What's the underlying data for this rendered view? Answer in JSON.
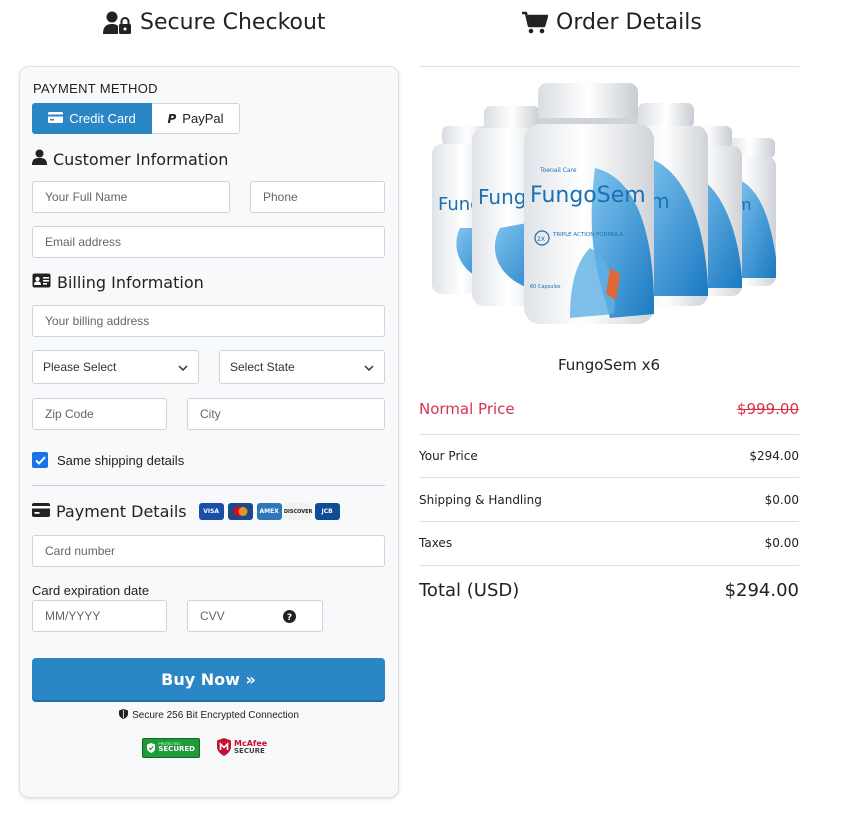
{
  "left_heading": "Secure Checkout",
  "right_heading": "Order Details",
  "payment": {
    "section_label": "PAYMENT METHOD",
    "tab_credit": "Credit Card",
    "tab_paypal": "PayPal"
  },
  "customer": {
    "title": "Customer Information",
    "full_name_placeholder": "Your Full Name",
    "phone_placeholder": "Phone",
    "email_placeholder": "Email address"
  },
  "billing": {
    "title": "Billing Information",
    "address_placeholder": "Your billing address",
    "country_select": "Please Select",
    "state_select": "Select State",
    "zip_placeholder": "Zip Code",
    "city_placeholder": "City",
    "same_shipping_label": "Same shipping details",
    "same_shipping_checked": true
  },
  "payment_details": {
    "title": "Payment Details",
    "card_logos": [
      "VISA",
      "MC",
      "AMEX",
      "DISCOVER",
      "JCB"
    ],
    "card_number_placeholder": "Card number",
    "expiry_label": "Card expiration date",
    "expiry_placeholder": "MM/YYYY",
    "cvv_placeholder": "CVV"
  },
  "buy_button": "Buy Now »",
  "secure_note": "Secure 256 Bit Encrypted Connection",
  "badges": {
    "secured_small": "SECURED",
    "secured_top": "PROTECTED",
    "mcafee_line1": "McAfee",
    "mcafee_line2": "SECURE"
  },
  "order": {
    "product_name": "FungoSem x6",
    "bottle_brand": "FungoSem",
    "bottle_tag": "Toenail Care",
    "bottle_formula": "TRIPLE ACTION FORMULA",
    "bottle_caps": "60 Capsules",
    "normal_price_label": "Normal Price",
    "normal_price_value": "$999.00",
    "your_price_label": "Your Price",
    "your_price_value": "$294.00",
    "shipping_label": "Shipping & Handling",
    "shipping_value": "$0.00",
    "taxes_label": "Taxes",
    "taxes_value": "$0.00",
    "total_label": "Total (USD)",
    "total_value": "$294.00"
  },
  "colors": {
    "primary": "#2b86c5",
    "strike_price": "#d9324d",
    "check_blue": "#1a73e8"
  }
}
